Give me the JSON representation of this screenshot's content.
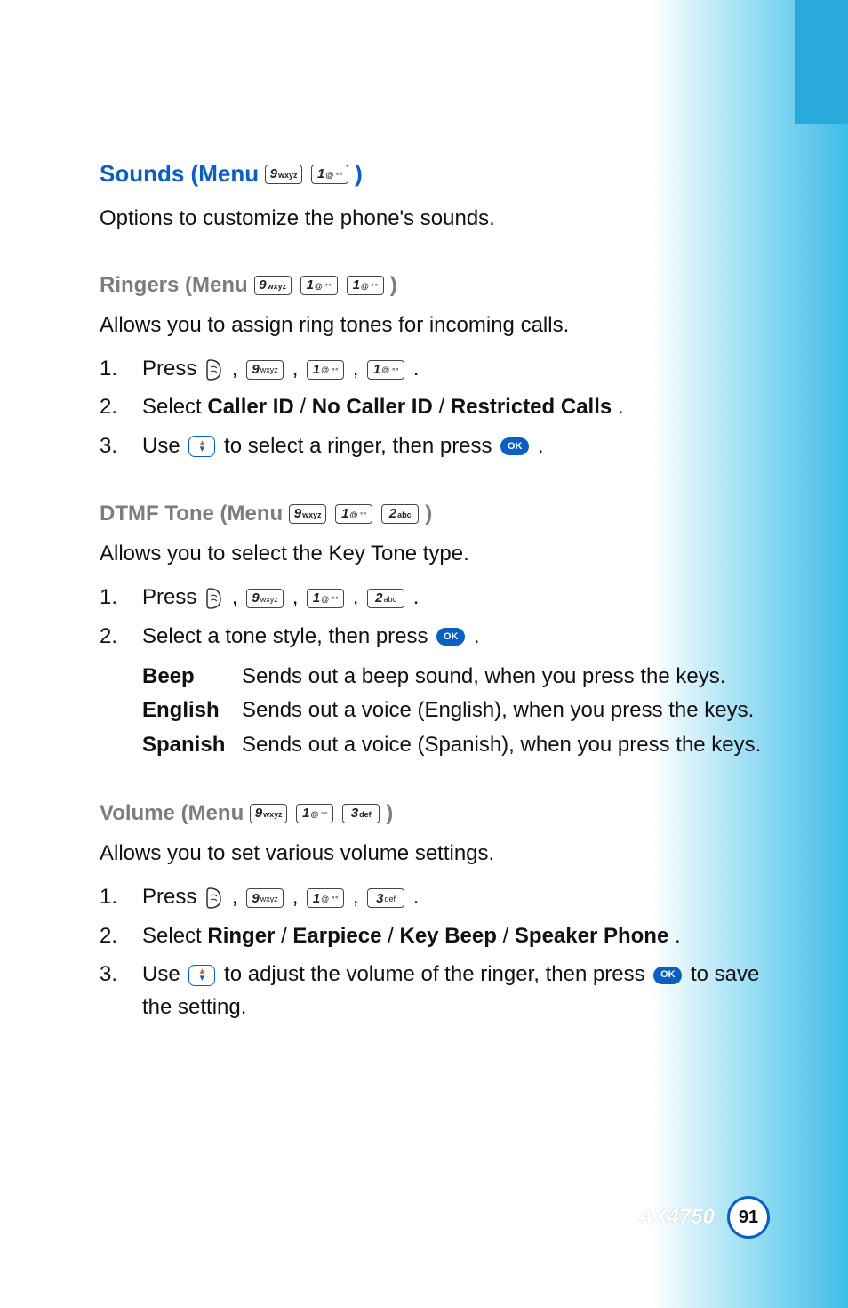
{
  "sounds": {
    "heading_prefix": "Sounds (Menu ",
    "heading_suffix": " )",
    "keys": [
      "9wxyz",
      "1@"
    ],
    "intro": "Options to customize the phone's sounds."
  },
  "ringers": {
    "heading_prefix": "Ringers (Menu ",
    "heading_suffix": " )",
    "keys": [
      "9wxyz",
      "1@",
      "1@"
    ],
    "intro": "Allows you to assign ring tones for incoming calls.",
    "steps": {
      "s1_num": "1.",
      "s1_a": "Press ",
      "s1_keys": [
        "9wxyz",
        "1@",
        "1@"
      ],
      "s2_num": "2.",
      "s2_a": "Select ",
      "s2_b": "Caller ID",
      "s2_c": " / ",
      "s2_d": "No Caller ID",
      "s2_e": " / ",
      "s2_f": "Restricted Calls",
      "s2_g": ".",
      "s3_num": "3.",
      "s3_a": "Use ",
      "s3_b": " to select a ringer, then press ",
      "s3_c": "."
    }
  },
  "dtmf": {
    "heading_prefix": "DTMF Tone (Menu ",
    "heading_suffix": " )",
    "keys": [
      "9wxyz",
      "1@",
      "2abc"
    ],
    "intro": "Allows you to select the Key Tone type.",
    "steps": {
      "s1_num": "1.",
      "s1_a": "Press ",
      "s1_keys": [
        "9wxyz",
        "1@",
        "2abc"
      ],
      "s2_num": "2.",
      "s2_a": "Select a tone style, then press ",
      "s2_b": " ."
    },
    "tones": {
      "beep_label": "Beep",
      "beep_desc": "Sends out a beep sound, when you press the keys.",
      "english_label": "English",
      "english_desc": "Sends out a voice (English), when you press the keys.",
      "spanish_label": "Spanish",
      "spanish_desc": "Sends out a voice (Spanish), when you press the keys."
    }
  },
  "volume": {
    "heading_prefix": "Volume (Menu ",
    "heading_suffix": " )",
    "keys": [
      "9wxyz",
      "1@",
      "3def"
    ],
    "intro": "Allows you to set various volume settings.",
    "steps": {
      "s1_num": "1.",
      "s1_a": "Press ",
      "s1_keys": [
        "9wxyz",
        "1@",
        "3def"
      ],
      "s2_num": "2.",
      "s2_a": "Select ",
      "s2_b": "Ringer",
      "s2_c": " / ",
      "s2_d": "Earpiece",
      "s2_e": " / ",
      "s2_f": "Key Beep",
      "s2_g": " / ",
      "s2_h": "Speaker Phone",
      "s2_i": ".",
      "s3_num": "3.",
      "s3_a": "Use ",
      "s3_b": " to adjust the volume of the ringer, then press ",
      "s3_c": " to save the setting."
    }
  },
  "keylabels": {
    "9wxyz": {
      "d": "9",
      "s": "wxyz"
    },
    "1@": {
      "d": "1",
      "s": "@"
    },
    "2abc": {
      "d": "2",
      "s": "abc"
    },
    "3def": {
      "d": "3",
      "s": "def"
    }
  },
  "ok_label": "OK",
  "comma": " , ",
  "period": ".",
  "footer": {
    "model": "AX4750",
    "page": "91"
  }
}
